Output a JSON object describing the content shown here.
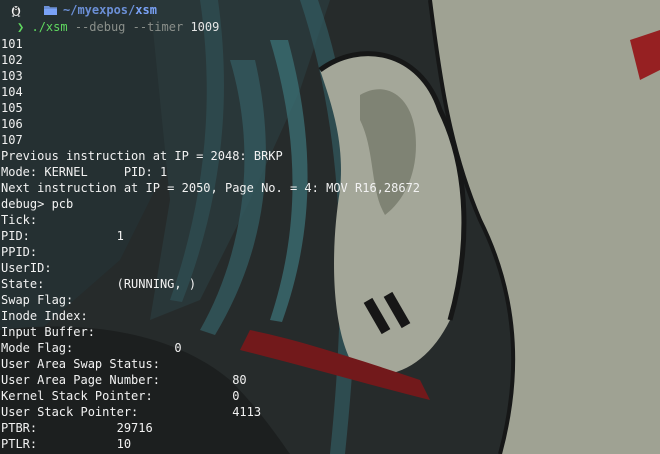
{
  "prompt": {
    "os_icon": "linux-tux-icon",
    "dir_icon": "folder-icon",
    "cwd_prefix": "~/myexpos/",
    "cwd_last": "xsm",
    "chevron": "❯",
    "command": "./xsm",
    "args": "--debug --timer",
    "timer_value": "1009"
  },
  "output": {
    "lines": [
      "101",
      "102",
      "103",
      "104",
      "105",
      "106",
      "107",
      "Previous instruction at IP = 2048: BRKP",
      "Mode: KERNEL     PID: 1",
      "Next instruction at IP = 2050, Page No. = 4: MOV R16,28672",
      "debug> pcb",
      "Tick:",
      "PID:            1",
      "PPID:",
      "UserID:",
      "State:          (RUNNING, )",
      "Swap Flag:",
      "Inode Index:",
      "Input Buffer:",
      "Mode Flag:              0",
      "User Area Swap Status:",
      "User Area Page Number:          80",
      "Kernel Stack Pointer:           0",
      "User Stack Pointer:             4113",
      "PTBR:           29716",
      "PTLR:           10"
    ]
  },
  "colors": {
    "prompt_green": "#5fd75f",
    "path_blue": "#7aa2f7",
    "text": "#f2f2f2",
    "args_gray": "#8a8f8a"
  }
}
